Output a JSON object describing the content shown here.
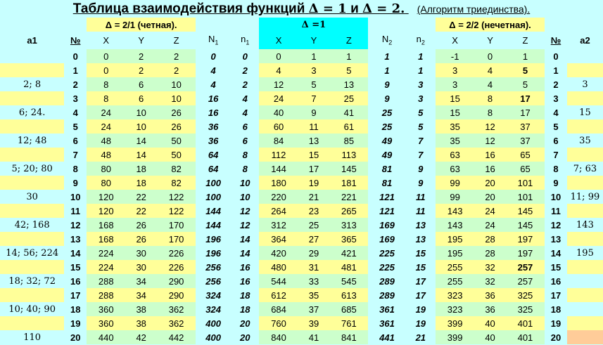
{
  "title": {
    "prefix": "Таблица взаимодействия функций",
    "delta1": "Δ = 1",
    "conj": "и",
    "delta2": "Δ = 2.",
    "subtitle": "(Алгоритм триединства)."
  },
  "subheaders": {
    "left": "Δ = 2/1 (четная).",
    "center": "Δ =1",
    "right": "Δ = 2/2 (нечетная)."
  },
  "headers": {
    "a1": "a1",
    "num": "№",
    "x": "X",
    "y": "Y",
    "z": "Z",
    "n1": "N",
    "n1_sub": "1",
    "nidx1": "n",
    "nidx1_sub": "1",
    "n2": "N",
    "n2_sub": "2",
    "nidx2": "n",
    "nidx2_sub": "2",
    "a2": "a2"
  },
  "colors": {
    "background": "#c8ffff",
    "yellow": "#ffff99",
    "green": "#ccffcc",
    "cyan": "#00ffff",
    "magenta": "#ff00ff",
    "blue": "#0000cc",
    "red": "#ff0000"
  },
  "a1_values": [
    "",
    "",
    "2;  8",
    "",
    "6;  24.",
    "",
    "12;  48",
    "",
    "5;  20;  80",
    "",
    "30",
    "",
    "42;  168",
    "",
    "14;  56;  224",
    "",
    "18;  32;  72",
    "",
    "10;   40;  90",
    "",
    "110"
  ],
  "a2_values": [
    "",
    "",
    "3",
    "",
    "15",
    "",
    "35",
    "",
    "7;  63",
    "",
    "11;  99",
    "",
    "143",
    "",
    "195",
    "",
    "",
    "",
    "",
    "",
    ""
  ],
  "rows": [
    {
      "num": "0",
      "x1": "0",
      "y1": "2",
      "z1": "2",
      "n1": "0",
      "i1": "0",
      "x": "0",
      "y": "1",
      "z": "1",
      "n2": "1",
      "i2": "1",
      "x2": "-1",
      "y2": "0",
      "z2": "1",
      "num2": "0"
    },
    {
      "num": "1",
      "x1": "0",
      "y1": "2",
      "z1": "2",
      "n1": "4",
      "i1": "2",
      "x": "4",
      "y": "3",
      "z": "5",
      "n2": "1",
      "i2": "1",
      "x2": "3",
      "y2": "4",
      "z2": "5",
      "num2": "1"
    },
    {
      "num": "2",
      "x1": "8",
      "y1": "6",
      "z1": "10",
      "n1": "4",
      "i1": "2",
      "x": "12",
      "y": "5",
      "z": "13",
      "n2": "9",
      "i2": "3",
      "x2": "3",
      "y2": "4",
      "z2": "5",
      "num2": "2"
    },
    {
      "num": "3",
      "x1": "8",
      "y1": "6",
      "z1": "10",
      "n1": "16",
      "i1": "4",
      "x": "24",
      "y": "7",
      "z": "25",
      "n2": "9",
      "i2": "3",
      "x2": "15",
      "y2": "8",
      "z2": "17",
      "num2": "3"
    },
    {
      "num": "4",
      "x1": "24",
      "y1": "10",
      "z1": "26",
      "n1": "16",
      "i1": "4",
      "x": "40",
      "y": "9",
      "z": "41",
      "n2": "25",
      "i2": "5",
      "x2": "15",
      "y2": "8",
      "z2": "17",
      "num2": "4"
    },
    {
      "num": "5",
      "x1": "24",
      "y1": "10",
      "z1": "26",
      "n1": "36",
      "i1": "6",
      "x": "60",
      "y": "11",
      "z": "61",
      "n2": "25",
      "i2": "5",
      "x2": "35",
      "y2": "12",
      "z2": "37",
      "num2": "5"
    },
    {
      "num": "6",
      "x1": "48",
      "y1": "14",
      "z1": "50",
      "n1": "36",
      "i1": "6",
      "x": "84",
      "y": "13",
      "z": "85",
      "n2": "49",
      "i2": "7",
      "x2": "35",
      "y2": "12",
      "z2": "37",
      "num2": "6"
    },
    {
      "num": "7",
      "x1": "48",
      "y1": "14",
      "z1": "50",
      "n1": "64",
      "i1": "8",
      "x": "112",
      "y": "15",
      "z": "113",
      "n2": "49",
      "i2": "7",
      "x2": "63",
      "y2": "16",
      "z2": "65",
      "num2": "7"
    },
    {
      "num": "8",
      "x1": "80",
      "y1": "18",
      "z1": "82",
      "n1": "64",
      "i1": "8",
      "x": "144",
      "y": "17",
      "z": "145",
      "n2": "81",
      "i2": "9",
      "x2": "63",
      "y2": "16",
      "z2": "65",
      "num2": "8"
    },
    {
      "num": "9",
      "x1": "80",
      "y1": "18",
      "z1": "82",
      "n1": "100",
      "i1": "10",
      "x": "180",
      "y": "19",
      "z": "181",
      "n2": "81",
      "i2": "9",
      "x2": "99",
      "y2": "20",
      "z2": "101",
      "num2": "9"
    },
    {
      "num": "10",
      "x1": "120",
      "y1": "22",
      "z1": "122",
      "n1": "100",
      "i1": "10",
      "x": "220",
      "y": "21",
      "z": "221",
      "n2": "121",
      "i2": "11",
      "x2": "99",
      "y2": "20",
      "z2": "101",
      "num2": "10"
    },
    {
      "num": "11",
      "x1": "120",
      "y1": "22",
      "z1": "122",
      "n1": "144",
      "i1": "12",
      "x": "264",
      "y": "23",
      "z": "265",
      "n2": "121",
      "i2": "11",
      "x2": "143",
      "y2": "24",
      "z2": "145",
      "num2": "11"
    },
    {
      "num": "12",
      "x1": "168",
      "y1": "26",
      "z1": "170",
      "n1": "144",
      "i1": "12",
      "x": "312",
      "y": "25",
      "z": "313",
      "n2": "169",
      "i2": "13",
      "x2": "143",
      "y2": "24",
      "z2": "145",
      "num2": "12"
    },
    {
      "num": "13",
      "x1": "168",
      "y1": "26",
      "z1": "170",
      "n1": "196",
      "i1": "14",
      "x": "364",
      "y": "27",
      "z": "365",
      "n2": "169",
      "i2": "13",
      "x2": "195",
      "y2": "28",
      "z2": "197",
      "num2": "13"
    },
    {
      "num": "14",
      "x1": "224",
      "y1": "30",
      "z1": "226",
      "n1": "196",
      "i1": "14",
      "x": "420",
      "y": "29",
      "z": "421",
      "n2": "225",
      "i2": "15",
      "x2": "195",
      "y2": "28",
      "z2": "197",
      "num2": "14"
    },
    {
      "num": "15",
      "x1": "224",
      "y1": "30",
      "z1": "226",
      "n1": "256",
      "i1": "16",
      "x": "480",
      "y": "31",
      "z": "481",
      "n2": "225",
      "i2": "15",
      "x2": "255",
      "y2": "32",
      "z2": "257",
      "num2": "15"
    },
    {
      "num": "16",
      "x1": "288",
      "y1": "34",
      "z1": "290",
      "n1": "256",
      "i1": "16",
      "x": "544",
      "y": "33",
      "z": "545",
      "n2": "289",
      "i2": "17",
      "x2": "255",
      "y2": "32",
      "z2": "257",
      "num2": "16"
    },
    {
      "num": "17",
      "x1": "288",
      "y1": "34",
      "z1": "290",
      "n1": "324",
      "i1": "18",
      "x": "612",
      "y": "35",
      "z": "613",
      "n2": "289",
      "i2": "17",
      "x2": "323",
      "y2": "36",
      "z2": "325",
      "num2": "17"
    },
    {
      "num": "18",
      "x1": "360",
      "y1": "38",
      "z1": "362",
      "n1": "324",
      "i1": "18",
      "x": "684",
      "y": "37",
      "z": "685",
      "n2": "361",
      "i2": "19",
      "x2": "323",
      "y2": "36",
      "z2": "325",
      "num2": "18"
    },
    {
      "num": "19",
      "x1": "360",
      "y1": "38",
      "z1": "362",
      "n1": "400",
      "i1": "20",
      "x": "760",
      "y": "39",
      "z": "761",
      "n2": "361",
      "i2": "19",
      "x2": "399",
      "y2": "40",
      "z2": "401",
      "num2": "19"
    },
    {
      "num": "20",
      "x1": "440",
      "y1": "42",
      "z1": "442",
      "n1": "400",
      "i1": "20",
      "x": "840",
      "y": "41",
      "z": "841",
      "n2": "441",
      "i2": "21",
      "x2": "399",
      "y2": "40",
      "z2": "401",
      "num2": "20"
    }
  ],
  "red_cells": [
    "1.z2",
    "3.z2",
    "15.z2"
  ]
}
